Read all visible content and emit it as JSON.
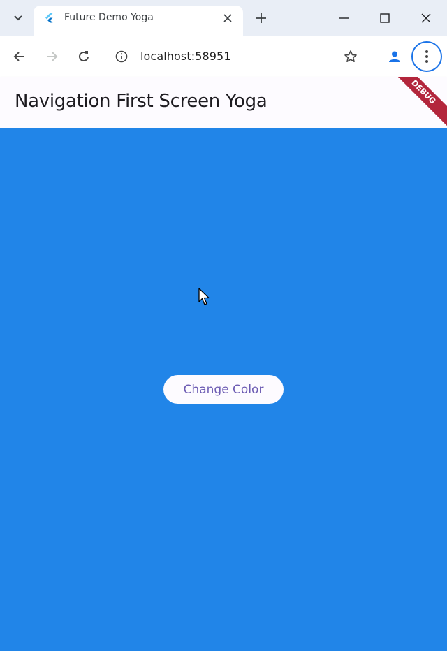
{
  "browser": {
    "tab": {
      "title": "Future Demo Yoga",
      "favicon": "flutter-icon"
    },
    "url": "localhost:58951",
    "window_controls": [
      "minimize",
      "maximize",
      "close"
    ]
  },
  "app": {
    "title": "Navigation First Screen Yoga",
    "debug_banner": "DEBUG",
    "button_label": "Change Color",
    "colors": {
      "background": "#2185e8",
      "appbar": "#fdfbff",
      "button_text": "#6c5bb3",
      "debug_banner": "#b3263c"
    }
  }
}
